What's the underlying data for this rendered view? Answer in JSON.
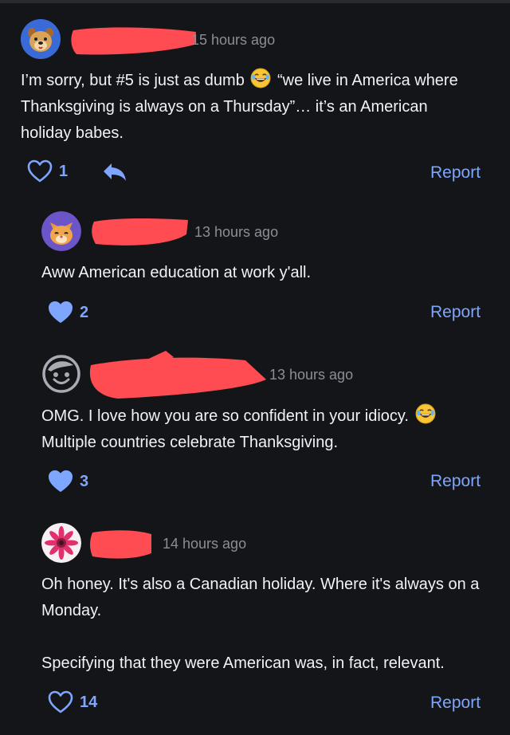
{
  "colors": {
    "background": "#141519",
    "text": "#f1f2f4",
    "meta": "#8b8e96",
    "accent": "#7ea6ff",
    "redaction": "#ff4b52"
  },
  "comments": [
    {
      "avatar": "dog-avatar-icon",
      "timestamp": "15 hours ago",
      "text": "I’m sorry, but #5 is just as dumb",
      "text_after_emoji": "“we live in America where Thanksgiving is always on a Thursday”… it’s an American holiday babes.",
      "likes": "1",
      "liked": false,
      "report_label": "Report"
    },
    {
      "avatar": "cat-avatar-icon",
      "timestamp": "13 hours ago",
      "text": "Aww American education at work y'all.",
      "likes": "2",
      "liked": true,
      "report_label": "Report"
    },
    {
      "avatar": "smiley-avatar-icon",
      "timestamp": "13 hours ago",
      "text": "OMG. I love how you are so confident in your idiocy.",
      "text_line2": "Multiple countries celebrate Thanksgiving.",
      "likes": "3",
      "liked": true,
      "report_label": "Report"
    },
    {
      "avatar": "flower-avatar-icon",
      "timestamp": "14 hours ago",
      "text": "Oh honey. It's also a Canadian holiday. Where it's always on a Monday.",
      "text_para2": "Specifying that they were American was, in fact, relevant.",
      "likes": "14",
      "liked": false,
      "report_label": "Report"
    }
  ]
}
